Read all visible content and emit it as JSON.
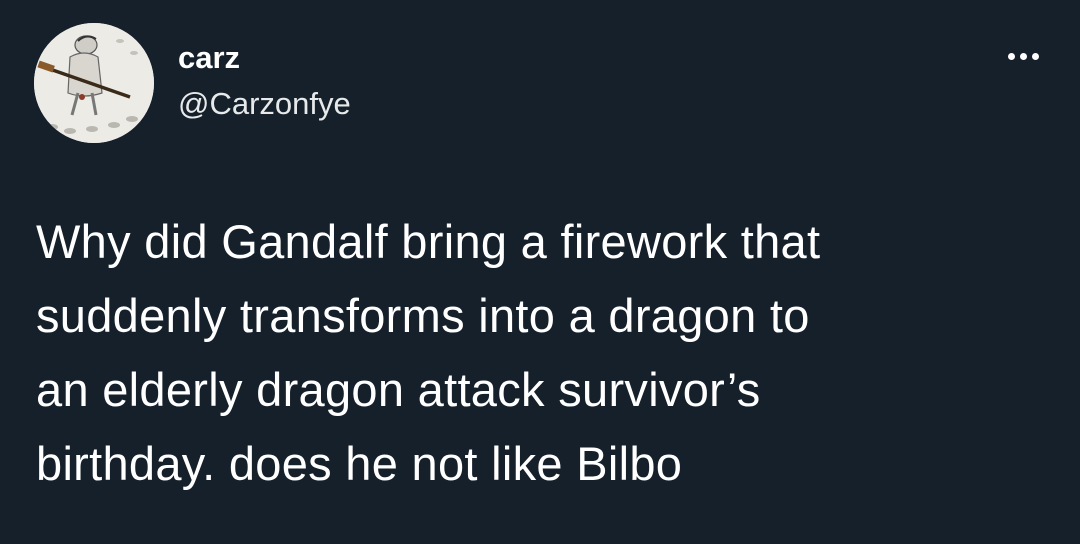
{
  "author": {
    "display_name": "carz",
    "handle": "@Carzonfye",
    "avatar_icon": "sketch-figure-with-rifle-avatar"
  },
  "actions": {
    "more_icon": "more-options-icon"
  },
  "tweet": {
    "lines": [
      "Why did Gandalf bring a firework that",
      "suddenly transforms into a dragon to",
      "an elderly dragon attack survivor’s",
      "birthday. does he not like Bilbo"
    ]
  },
  "colors": {
    "background": "#15202b",
    "text": "#ffffff"
  }
}
